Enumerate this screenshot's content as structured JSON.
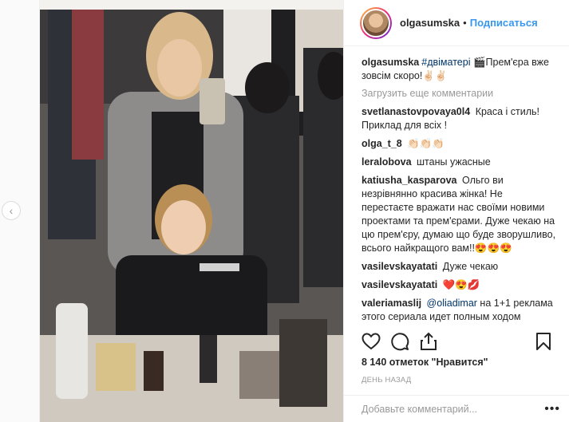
{
  "post": {
    "username": "olgasumska",
    "separator": "•",
    "follow_label": "Подписаться",
    "caption_user": "olgasumska",
    "caption_tag": "#двіматері",
    "caption_text": " 🎬Прем'єра вже зовсім скоро!✌🏻✌🏻",
    "load_more": "Загрузить еще комментарии",
    "likes": "8 140 отметок \"Нравится\"",
    "time": "день назад",
    "add_comment_placeholder": "Добавьте комментарий...",
    "more_icon": "•••"
  },
  "comments": [
    {
      "user": "svetlanastovpovaya0l4",
      "text": "Краса і стиль! Приклад для всіх !"
    },
    {
      "user": "olga_t_8",
      "text": "👏🏻👏🏻👏🏻"
    },
    {
      "user": "leralobova",
      "text": "штаны ужасные"
    },
    {
      "user": "katiusha_kasparova",
      "text": "Ольго ви незрівнянно красива жінка! Не перестаєте вражати нас своїми новими проектами та прем'єрами. Дуже чекаю на цю прем'єру, думаю що буде зворушливо, всього найкращого вам!!😍😍😍"
    },
    {
      "user": "vasilevskayatati",
      "text": "Дуже чекаю"
    },
    {
      "user": "vasilevskayatati",
      "text": "❤️😍💋"
    },
    {
      "user": "valeriamaslij",
      "mention": "@oliadimar",
      "text": " на 1+1 реклама этого сериала идет полным ходом"
    }
  ],
  "icons": {
    "heart": "heart-icon",
    "comment": "comment-icon",
    "share": "share-icon",
    "bookmark": "bookmark-icon",
    "prev": "chevron-left-icon"
  }
}
